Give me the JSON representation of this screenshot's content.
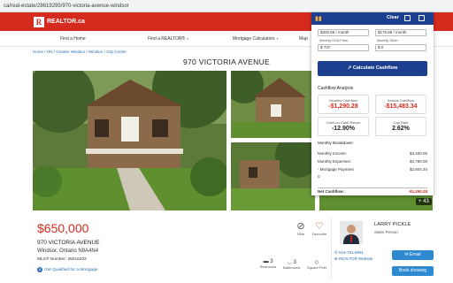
{
  "browser": {
    "url": "ca/real-estate/28619295/970-victoria-avenue-windsor"
  },
  "site": {
    "logo_mark": "R",
    "logo_text": "REALTOR.ca",
    "nav": [
      {
        "label": "Find a Home",
        "chevron": ""
      },
      {
        "label": "Find a REALTOR®",
        "chevron": "▾"
      },
      {
        "label": "Mortgage Calculators",
        "chevron": "▾"
      },
      {
        "label": "Map",
        "chevron": ""
      }
    ],
    "breadcrumb": "Home / ON / Greater Windsor / Windsor / City Centre"
  },
  "listing": {
    "title": "970 VICTORIA AVENUE",
    "price": "$650,000",
    "address": "970 VICTORIA AVENUE",
    "city": "Windsor, Ontario N9A4N4",
    "mls": "MLS® Number: 25016202",
    "prequal": "Get Qualified for a Mortgage",
    "photo_count": "+ 43",
    "actions": {
      "hide": "Hide",
      "favourite": "Favourite"
    },
    "stats": [
      {
        "value": "3",
        "label": "Bedrooms",
        "icon": "bed-icon"
      },
      {
        "value": "3",
        "label": "Bathrooms",
        "icon": "bath-icon"
      },
      {
        "value": "",
        "label": "Square Feet",
        "icon": "square-feet-icon"
      }
    ]
  },
  "agent": {
    "name": "LARRY PICKLE",
    "role": "Sales Person",
    "phone": "519-791-9691",
    "website": "REALTOR Website",
    "email_button": "Email",
    "book_button": "Book showing"
  },
  "panel": {
    "clear_label": "Clear",
    "inputs": {
      "top_left_value": "$200.56 / month",
      "top_right_value": "$176.88 / month",
      "hoa_label": "Monthly HOA Fees",
      "hoa_value": "$ 737",
      "other_label": "Monthly Other",
      "other_value": "$ 0"
    },
    "calculate_button": "Calculate Cashflow",
    "analysis_title": "Cashflow Analysis",
    "metrics": {
      "monthly_cashflow": {
        "label": "Monthly Cashflow",
        "value": "-$1,290.28"
      },
      "annual_cashflow": {
        "label": "Annual Cashflow",
        "value": "-$15,483.34"
      },
      "coc_return": {
        "label": "Cash-on-Cash Return",
        "value": "-12.90%"
      },
      "cap_rate": {
        "label": "Cap Rate",
        "value": "2.62%"
      }
    },
    "breakdown_title": "Monthly Breakdown:",
    "breakdown": [
      {
        "label": "Monthly Income:",
        "value": "$3,400.00"
      },
      {
        "label": "Monthly Expenses:",
        "value": "$4,760.00"
      },
      {
        "label": "- Mortgage Payment",
        "value": "$2,604.34"
      },
      {
        "label": "0",
        "value": ""
      }
    ],
    "net_label": "Net Cashflow:",
    "net_value": "-$1,290.28"
  },
  "colors": {
    "brand_red": "#d52b1e",
    "panel_navy": "#1d3f8f",
    "link_blue": "#2a6fb0",
    "button_blue": "#2e89d1"
  }
}
